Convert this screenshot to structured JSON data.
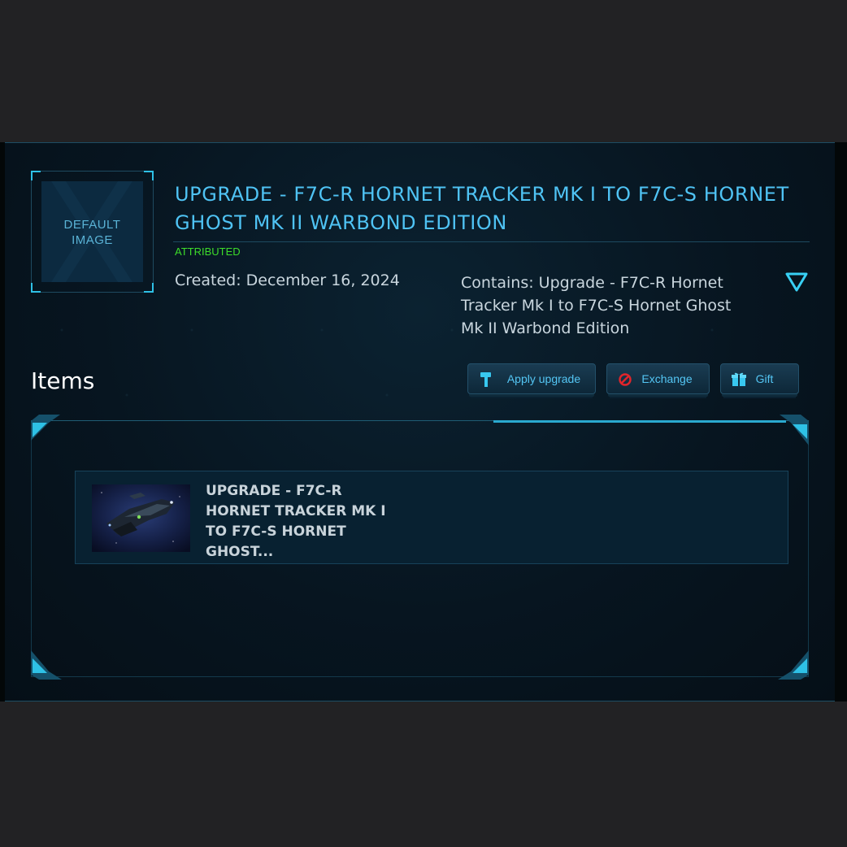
{
  "thumbnail": {
    "line1": "DEFAULT",
    "line2": "IMAGE"
  },
  "pledge": {
    "title": "UPGRADE - F7C-R HORNET TRACKER MK I TO F7C-S HORNET GHOST MK II WARBOND EDITION",
    "status": "ATTRIBUTED",
    "status_color": "#3ddc2a",
    "created": "Created: December 16, 2024",
    "contains": "Contains: Upgrade - F7C-R Hornet Tracker Mk I to F7C-S Hornet Ghost Mk II Warbond Edition",
    "expand_icon": "triangle-down-icon"
  },
  "items_section": {
    "heading": "Items",
    "actions": {
      "apply": {
        "label": "Apply upgrade",
        "icon": "hammer-icon"
      },
      "exchange": {
        "label": "Exchange",
        "icon": "prohibited-icon"
      },
      "gift": {
        "label": "Gift",
        "icon": "gift-box-icon"
      }
    },
    "list": [
      {
        "title": "UPGRADE - F7C-R HORNET TRACKER MK I TO F7C-S HORNET GHOST...",
        "image": "ship-image"
      }
    ]
  },
  "colors": {
    "accent": "#2ec1e6",
    "title": "#4fc3f4",
    "background": "#071520",
    "danger": "#e0252b"
  }
}
